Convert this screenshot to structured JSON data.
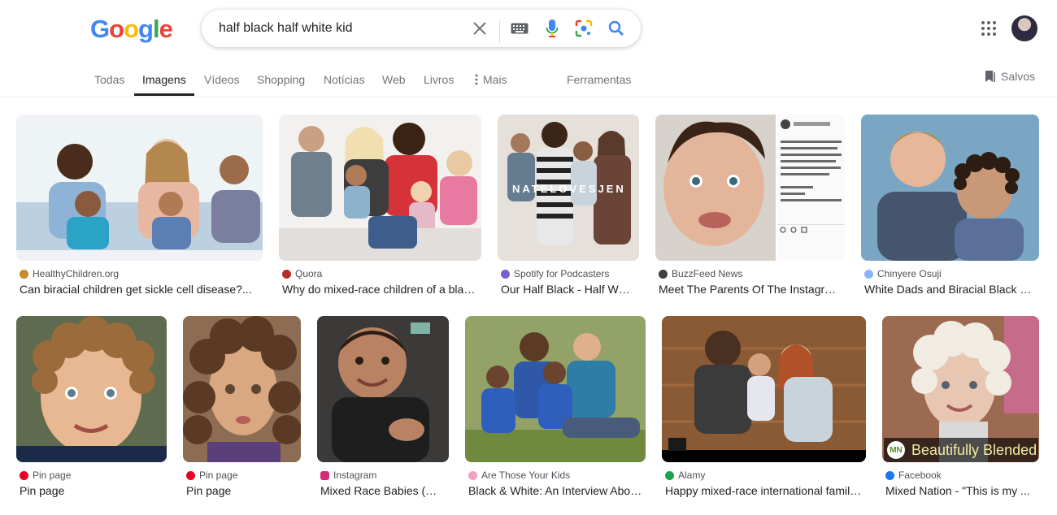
{
  "logo": {
    "letters": [
      "G",
      "o",
      "o",
      "g",
      "l",
      "e"
    ],
    "colors": [
      "#4285f4",
      "#ea4335",
      "#fbbc05",
      "#4285f4",
      "#34a853",
      "#ea4335"
    ]
  },
  "search": {
    "query": "half black half white kid",
    "icons": [
      "close-icon",
      "keyboard-icon",
      "microphone-icon",
      "lens-icon",
      "search-icon"
    ]
  },
  "tabs": {
    "items": [
      {
        "label": "Todas",
        "active": false
      },
      {
        "label": "Imagens",
        "active": true
      },
      {
        "label": "Vídeos",
        "active": false
      },
      {
        "label": "Shopping",
        "active": false
      },
      {
        "label": "Notícias",
        "active": false
      },
      {
        "label": "Web",
        "active": false
      },
      {
        "label": "Livros",
        "active": false
      },
      {
        "label": "Mais",
        "active": false
      }
    ],
    "tools": "Ferramentas",
    "saved": "Salvos"
  },
  "results": [
    {
      "source": "HealthyChildren.org",
      "title": "Can biracial children get sickle cell disease?...",
      "source_color": "#c88a2a"
    },
    {
      "source": "Quora",
      "title": "Why do mixed-race children of a black...",
      "source_color": "#b92b27"
    },
    {
      "source": "Spotify for Podcasters",
      "title": "Our Half Black - Half White Family...",
      "source_color": "#7b5fd1",
      "overlay": "NATELOVESJEN"
    },
    {
      "source": "BuzzFeed News",
      "title": "Meet The Parents Of The Instagram...",
      "source_color": "#3c4043"
    },
    {
      "source": "Chinyere Osuji",
      "title": "White Dads and Biracial Black Kids...",
      "source_color": "#8ab4f8"
    },
    {
      "source": "Pin page",
      "title": "Pin page",
      "source_color": "#e60023"
    },
    {
      "source": "Pin page",
      "title": "Pin page",
      "source_color": "#e60023"
    },
    {
      "source": "Instagram",
      "title": "Mixed Race Babies (@...",
      "source_color": "#d62976"
    },
    {
      "source": "Are Those Your Kids",
      "title": "Black & White: An Interview About...",
      "source_color": "#f2a0c0"
    },
    {
      "source": "Alamy",
      "title": "Happy mixed-race international family...",
      "source_color": "#1ba34a"
    },
    {
      "source": "Facebook",
      "title": "Mixed Nation - \"This is my ...",
      "source_color": "#1877f2",
      "badge": "Beautifully Blended",
      "badge_logo": "MN"
    }
  ]
}
